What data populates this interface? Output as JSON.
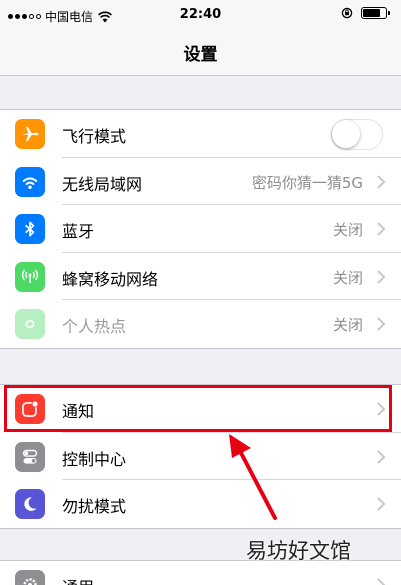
{
  "statusbar": {
    "carrier": "中国电信",
    "time": "22:40",
    "battery_level": 0.8
  },
  "navbar": {
    "title": "设置"
  },
  "group1": [
    {
      "label": "飞行模式",
      "icon": "airplane-icon",
      "icon_color": "#ff9500",
      "toggle_on": false
    },
    {
      "label": "无线局域网",
      "icon": "wifi-icon",
      "icon_color": "#007aff",
      "value": "密码你猜一猜5G"
    },
    {
      "label": "蓝牙",
      "icon": "bluetooth-icon",
      "icon_color": "#007aff",
      "value": "关闭"
    },
    {
      "label": "蜂窝移动网络",
      "icon": "cellular-icon",
      "icon_color": "#4cd964",
      "value": "关闭"
    },
    {
      "label": "个人热点",
      "icon": "hotspot-icon",
      "icon_color": "#4cd964",
      "value": "关闭"
    }
  ],
  "group2": [
    {
      "label": "通知",
      "icon": "notifications-icon",
      "icon_color": "#ff3b30"
    },
    {
      "label": "控制中心",
      "icon": "control-center-icon",
      "icon_color": "#8e8e93"
    },
    {
      "label": "勿扰模式",
      "icon": "moon-icon",
      "icon_color": "#5856d6"
    }
  ],
  "group3": [
    {
      "label": "通用",
      "icon": "gear-icon",
      "icon_color": "#8e8e93"
    }
  ],
  "watermark": "易坊好文馆"
}
